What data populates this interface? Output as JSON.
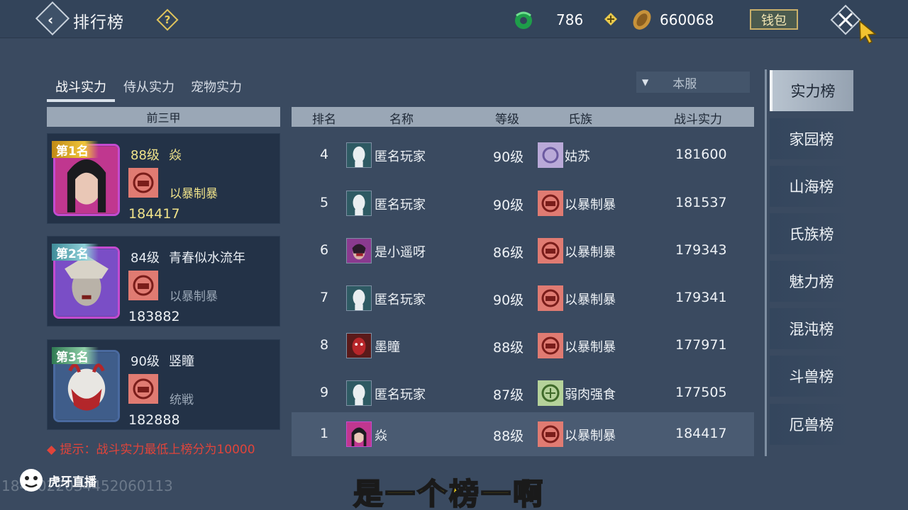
{
  "header": {
    "title": "排行榜",
    "help_label": "?",
    "jade_value": "786",
    "coin_value": "660068",
    "wallet_label": "钱包"
  },
  "tabs": [
    {
      "label": "战斗实力"
    },
    {
      "label": "侍从实力"
    },
    {
      "label": "宠物实力"
    }
  ],
  "server_filter": "本服",
  "top3": {
    "header": "前三甲",
    "cards": [
      {
        "rank_label": "第1名",
        "level": "88级",
        "name": "焱",
        "clan": "以暴制暴",
        "score": "184417"
      },
      {
        "rank_label": "第2名",
        "level": "84级",
        "name": "青春似水流年",
        "clan": "以暴制暴",
        "score": "183882"
      },
      {
        "rank_label": "第3名",
        "level": "90级",
        "name": "竖瞳",
        "clan": "统戦",
        "score": "182888"
      }
    ]
  },
  "hint": "提示：战斗实力最低上榜分为10000",
  "table": {
    "columns": [
      "排名",
      "名称",
      "等级",
      "氏族",
      "战斗实力"
    ],
    "rows": [
      {
        "rank": "4",
        "name": "匿名玩家",
        "level": "90级",
        "clan": "姑苏",
        "score": "181600"
      },
      {
        "rank": "5",
        "name": "匿名玩家",
        "level": "90级",
        "clan": "以暴制暴",
        "score": "181537"
      },
      {
        "rank": "6",
        "name": "是小遥呀",
        "level": "86级",
        "clan": "以暴制暴",
        "score": "179343"
      },
      {
        "rank": "7",
        "name": "匿名玩家",
        "level": "90级",
        "clan": "以暴制暴",
        "score": "179341"
      },
      {
        "rank": "8",
        "name": "墨瞳",
        "level": "88级",
        "clan": "以暴制暴",
        "score": "177971"
      },
      {
        "rank": "9",
        "name": "匿名玩家",
        "level": "87级",
        "clan": "弱肉强食",
        "score": "177505"
      }
    ],
    "my_row": {
      "rank": "1",
      "name": "焱",
      "level": "88级",
      "clan": "以暴制暴",
      "score": "184417"
    }
  },
  "side_nav": [
    {
      "label": "实力榜"
    },
    {
      "label": "家园榜"
    },
    {
      "label": "山海榜"
    },
    {
      "label": "氏族榜"
    },
    {
      "label": "魅力榜"
    },
    {
      "label": "混沌榜"
    },
    {
      "label": "斗兽榜"
    },
    {
      "label": "厄兽榜"
    }
  ],
  "footer": {
    "logo_text": "虎牙直播",
    "watermark": "1845022034452060113",
    "subtitle": "是一个榜一啊"
  },
  "colors": {
    "background": "#3a4a60",
    "header_bar": "#9aa7b6",
    "gold_text": "#f0e38a",
    "hint_red": "#e1443a",
    "subtitle_yellow": "#f4d51c"
  }
}
